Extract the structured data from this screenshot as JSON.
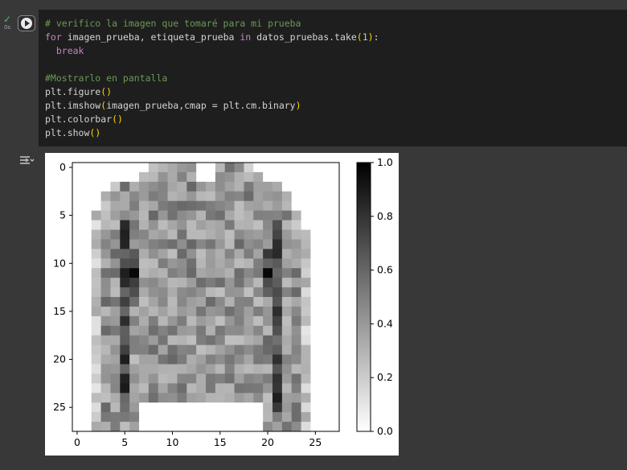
{
  "cell": {
    "exec_time": "0s",
    "status_icon": "check-icon",
    "lines": [
      [
        {
          "t": "# verifico la imagen que tomaré para mi prueba",
          "c": "comment"
        }
      ],
      [
        {
          "t": "for",
          "c": "kw"
        },
        {
          "t": " imagen_prueba, etiqueta_prueba ",
          "c": "ident"
        },
        {
          "t": "in",
          "c": "kw"
        },
        {
          "t": " datos_pruebas.take",
          "c": "ident"
        },
        {
          "t": "(",
          "c": "paren"
        },
        {
          "t": "1",
          "c": "num"
        },
        {
          "t": ")",
          "c": "paren"
        },
        {
          "t": ":",
          "c": "ident"
        }
      ],
      [
        {
          "t": "  ",
          "c": "ident"
        },
        {
          "t": "break",
          "c": "ctrl"
        }
      ],
      [],
      [
        {
          "t": "#Mostrarlo en pantalla",
          "c": "comment"
        }
      ],
      [
        {
          "t": "plt.figure",
          "c": "ident"
        },
        {
          "t": "()",
          "c": "paren"
        }
      ],
      [
        {
          "t": "plt.imshow",
          "c": "ident"
        },
        {
          "t": "(",
          "c": "paren"
        },
        {
          "t": "imagen_prueba,cmap = plt.cm.binary",
          "c": "ident"
        },
        {
          "t": ")",
          "c": "paren"
        }
      ],
      [
        {
          "t": "plt.colorbar",
          "c": "ident"
        },
        {
          "t": "()",
          "c": "paren"
        }
      ],
      [
        {
          "t": "plt.show",
          "c": "ident"
        },
        {
          "t": "()",
          "c": "paren"
        }
      ]
    ]
  },
  "chart_data": {
    "type": "heatmap",
    "cmap": "binary",
    "rows": 28,
    "cols": 28,
    "xticks": [
      "0",
      "5",
      "10",
      "15",
      "20",
      "25"
    ],
    "yticks": [
      "0",
      "5",
      "10",
      "15",
      "20",
      "25"
    ],
    "colorbar": {
      "range": [
        0.0,
        1.0
      ],
      "ticks": [
        "0.0",
        "0.2",
        "0.4",
        "0.6",
        "0.8",
        "1.0"
      ]
    },
    "sweater_shape": {
      "top_row": 0,
      "collar_rows": [
        0,
        1
      ],
      "collar_span": [
        8,
        18
      ],
      "neck_gap": [
        13,
        14
      ],
      "shoulder_span_by_row": [
        [
          8,
          18
        ],
        [
          7,
          19
        ],
        [
          4,
          21
        ],
        [
          3,
          22
        ],
        [
          3,
          22
        ],
        [
          2,
          23
        ],
        [
          2,
          23
        ],
        [
          2,
          24
        ],
        [
          2,
          24
        ],
        [
          2,
          24
        ],
        [
          2,
          24
        ]
      ],
      "body_span": [
        2,
        24
      ],
      "hem_gap_rows": [
        25,
        27
      ],
      "hem_gap_cols": [
        7,
        19
      ]
    }
  }
}
